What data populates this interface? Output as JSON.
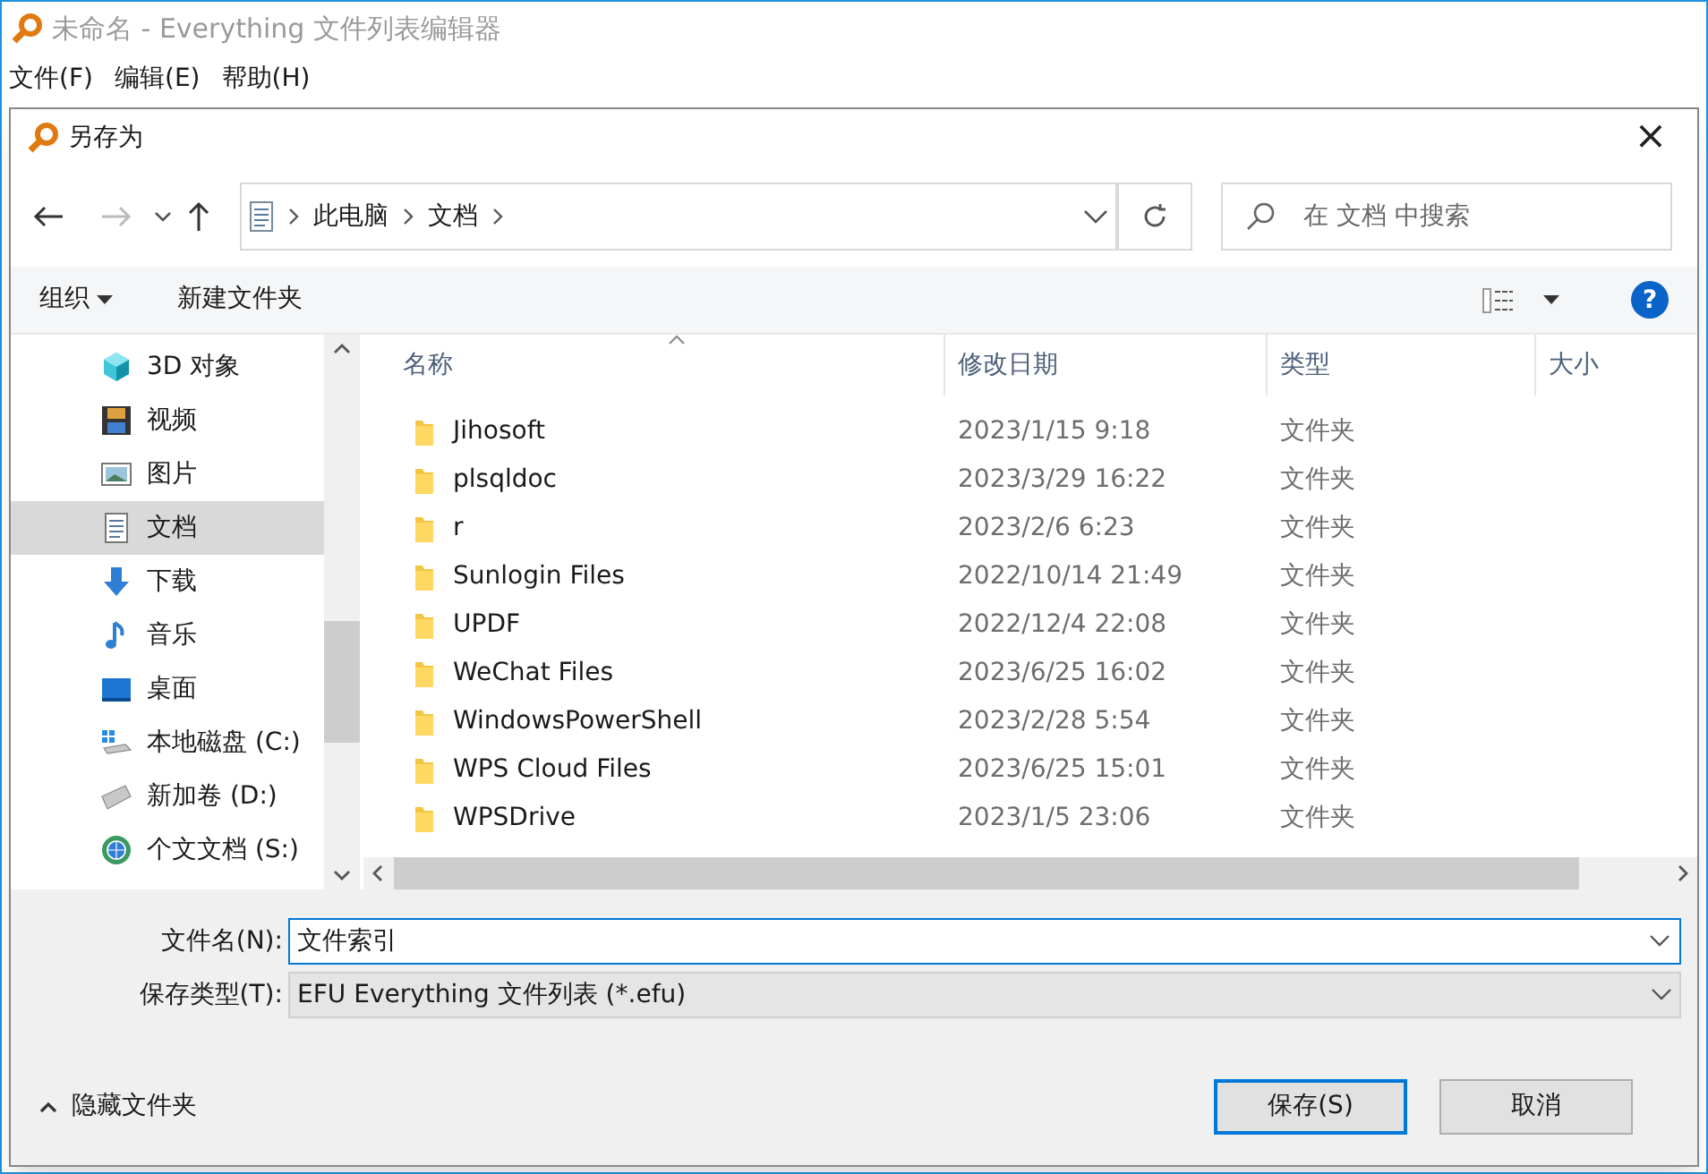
{
  "app_window": {
    "title": "未命名 - Everything 文件列表编辑器",
    "menu": [
      "文件(F)",
      "编辑(E)",
      "帮助(H)"
    ]
  },
  "dialog": {
    "title": "另存为",
    "close": "×"
  },
  "address": {
    "crumbs": [
      "此电脑",
      "文档"
    ]
  },
  "search": {
    "placeholder": "在 文档 中搜索"
  },
  "toolbar": {
    "organize": "组织",
    "new_folder": "新建文件夹",
    "help": "?"
  },
  "sidebar": {
    "items": [
      {
        "label": "3D 对象",
        "kind": "cube",
        "selected": false
      },
      {
        "label": "视频",
        "kind": "video",
        "selected": false
      },
      {
        "label": "图片",
        "kind": "picture",
        "selected": false
      },
      {
        "label": "文档",
        "kind": "document",
        "selected": true
      },
      {
        "label": "下载",
        "kind": "download",
        "selected": false
      },
      {
        "label": "音乐",
        "kind": "music",
        "selected": false
      },
      {
        "label": "桌面",
        "kind": "desktop",
        "selected": false
      },
      {
        "label": "本地磁盘 (C:)",
        "kind": "system-drive",
        "selected": false
      },
      {
        "label": "新加卷 (D:)",
        "kind": "drive",
        "selected": false
      },
      {
        "label": "个文文档 (S:)",
        "kind": "network",
        "selected": false
      }
    ]
  },
  "table": {
    "columns": [
      "名称",
      "修改日期",
      "类型",
      "大小"
    ],
    "rows": [
      {
        "name": "Jihosoft",
        "date": "2023/1/15 9:18",
        "type": "文件夹"
      },
      {
        "name": "plsqldoc",
        "date": "2023/3/29 16:22",
        "type": "文件夹"
      },
      {
        "name": "r",
        "date": "2023/2/6 6:23",
        "type": "文件夹"
      },
      {
        "name": "Sunlogin Files",
        "date": "2022/10/14 21:49",
        "type": "文件夹"
      },
      {
        "name": "UPDF",
        "date": "2022/12/4 22:08",
        "type": "文件夹"
      },
      {
        "name": "WeChat Files",
        "date": "2023/6/25 16:02",
        "type": "文件夹"
      },
      {
        "name": "WindowsPowerShell",
        "date": "2023/2/28 5:54",
        "type": "文件夹"
      },
      {
        "name": "WPS Cloud Files",
        "date": "2023/6/25 15:01",
        "type": "文件夹"
      },
      {
        "name": "WPSDrive",
        "date": "2023/1/5 23:06",
        "type": "文件夹"
      }
    ]
  },
  "filename": {
    "label": "文件名(N):",
    "value": "文件索引"
  },
  "filetype": {
    "label": "保存类型(T):",
    "value": "EFU Everything 文件列表 (*.efu)"
  },
  "hide_folders": "隐藏文件夹",
  "buttons": [
    {
      "label": "保存(S)",
      "kind": "primary"
    },
    {
      "label": "取消",
      "kind": "normal"
    }
  ]
}
